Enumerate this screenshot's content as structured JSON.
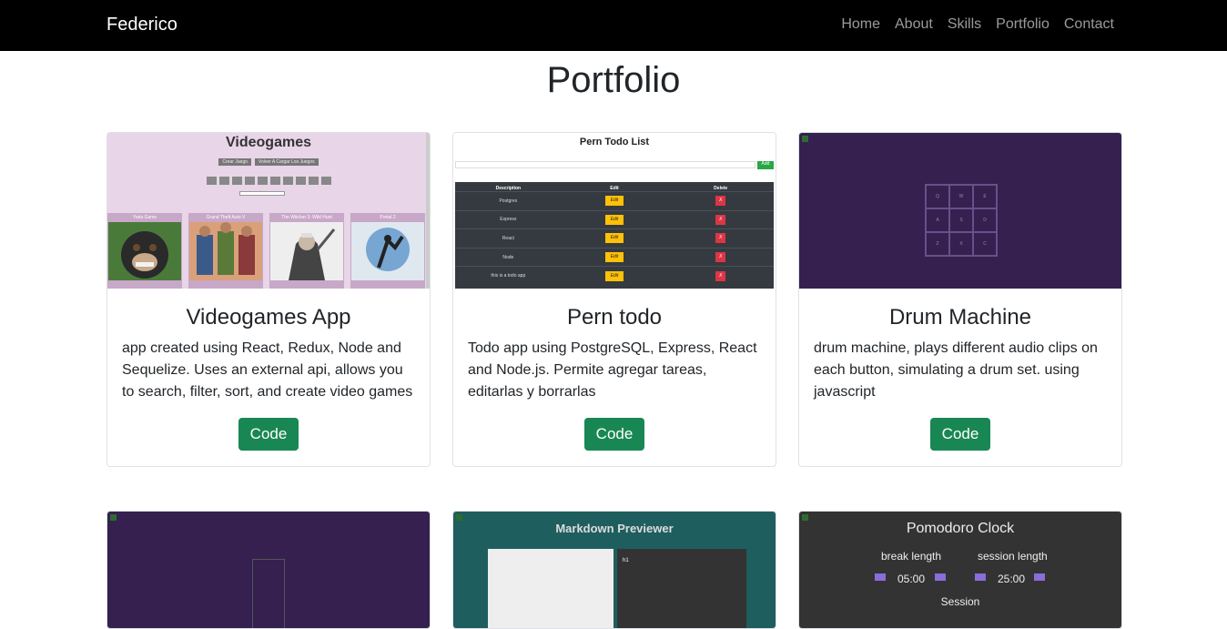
{
  "navbar": {
    "brand": "Federico",
    "links": [
      "Home",
      "About",
      "Skills",
      "Portfolio",
      "Contact"
    ]
  },
  "page_title": "Portfolio",
  "projects": [
    {
      "title": "Videogames App",
      "description": "app created using React, Redux, Node and Sequelize. Uses an external api, allows you to search, filter, sort, and create video games",
      "button": "Code",
      "thumb": {
        "heading": "Videogames",
        "buttons": [
          "Crear Juego",
          "Volver A Cargar Los Juegos"
        ],
        "games": [
          "Yoda Game",
          "Grand Theft Auto V",
          "The Witcher 3: Wild Hunt",
          "Portal 2"
        ]
      }
    },
    {
      "title": "Pern todo",
      "description": "Todo app using PostgreSQL, Express, React and Node.js. Permite agregar tareas, editarlas y borrarlas",
      "button": "Code",
      "thumb": {
        "heading": "Pern Todo List",
        "add": "Add",
        "columns": [
          "Description",
          "Edit",
          "Delete"
        ],
        "rows": [
          "Postgres",
          "Express",
          "React",
          "Node",
          "this is a todo app"
        ],
        "edit": "Edit",
        "delete": "X"
      }
    },
    {
      "title": "Drum Machine",
      "description": "drum machine, plays different audio clips on each button, simulating a drum set. using javascript",
      "button": "Code",
      "thumb": {
        "pads": [
          "Q",
          "W",
          "E",
          "A",
          "S",
          "D",
          "Z",
          "X",
          "C"
        ]
      }
    }
  ],
  "row2": {
    "markdown": {
      "heading": "Markdown Previewer",
      "preview": "h1"
    },
    "pomodoro": {
      "heading": "Pomodoro Clock",
      "break_label": "break length",
      "session_label": "session length",
      "break_value": "05:00",
      "session_value": "25:00",
      "session": "Session"
    }
  },
  "colors": {
    "navbar": "#000000",
    "button": "#198754",
    "drum_bg": "#35204f",
    "vg_bg": "#e8d5e8"
  }
}
